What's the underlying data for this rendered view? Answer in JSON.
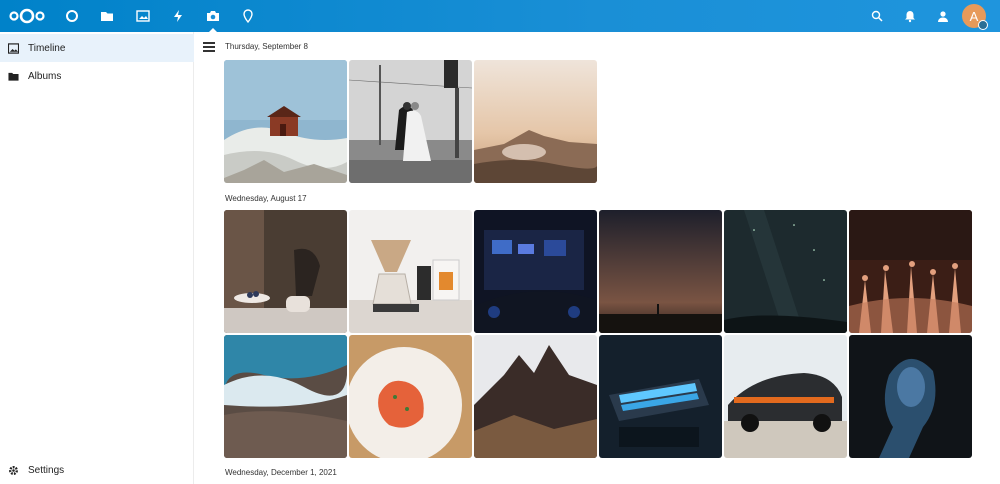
{
  "header": {
    "avatar_initial": "A",
    "nav_icons": [
      "dashboard-icon",
      "files-icon",
      "photos-icon",
      "activity-icon",
      "camera-icon",
      "maps-icon"
    ],
    "right_icons": [
      "search-icon",
      "notifications-icon",
      "contacts-icon"
    ],
    "accent": "#0082c9"
  },
  "sidebar": {
    "items": [
      {
        "label": "Timeline",
        "icon": "image-icon",
        "active": true
      },
      {
        "label": "Albums",
        "icon": "folder-icon",
        "active": false
      }
    ],
    "settings_label": "Settings"
  },
  "timeline": {
    "groups": [
      {
        "date": "Thursday, September 8"
      },
      {
        "date": "Wednesday, August 17"
      },
      {
        "date": "Wednesday, December 1, 2021"
      }
    ]
  }
}
